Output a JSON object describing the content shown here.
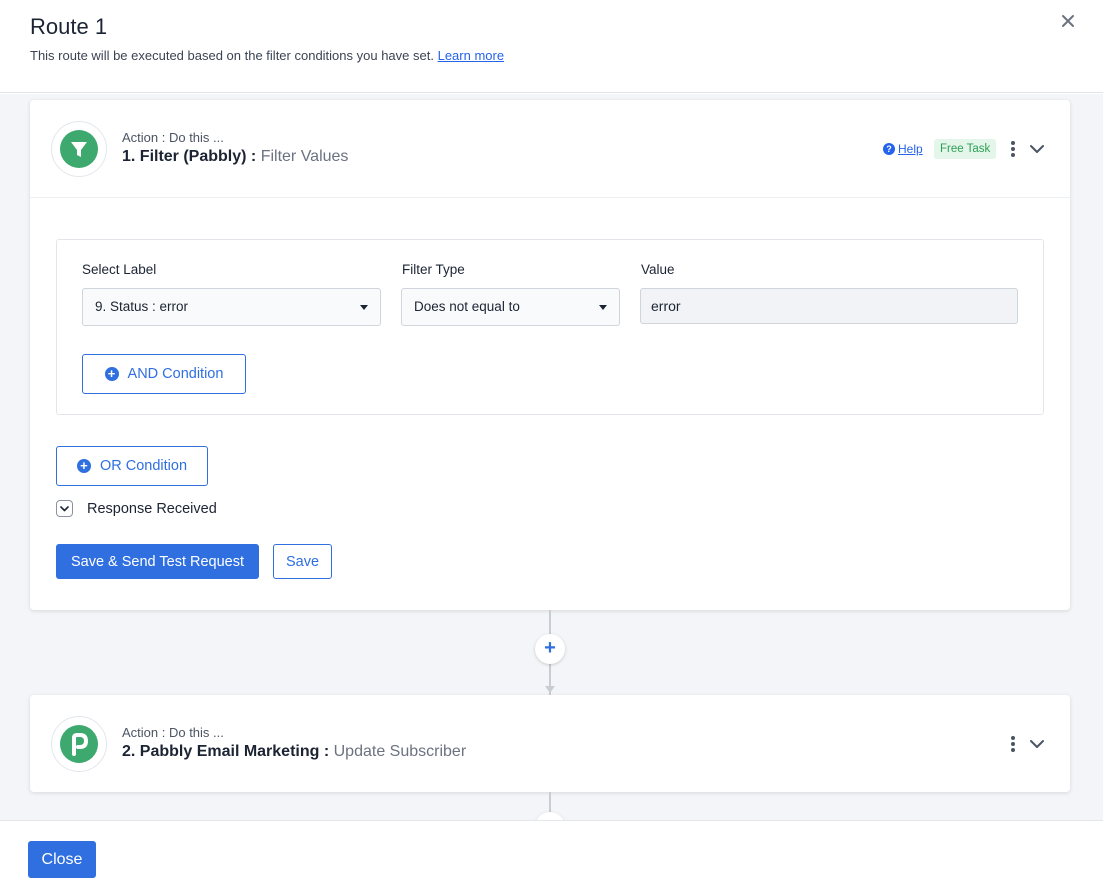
{
  "modal": {
    "title": "Route 1",
    "subtitle": "This route will be executed based on the filter conditions you have set.",
    "learn_more": "Learn more"
  },
  "step1": {
    "kicker": "Action : Do this ...",
    "app_name": "1. Filter (Pabbly) : ",
    "event": "Filter Values",
    "help_label": "Help",
    "badge": "Free Task",
    "columns": {
      "select_label": "Select Label",
      "filter_type": "Filter Type",
      "value": "Value"
    },
    "condition": {
      "label_value": "9. Status : error",
      "filter_type_value": "Does not equal to",
      "value": "error"
    },
    "and_condition": "AND Condition",
    "or_condition": "OR Condition",
    "response_label": "Response Received",
    "save_send": "Save & Send Test Request",
    "save": "Save"
  },
  "step2": {
    "kicker": "Action : Do this ...",
    "app_name": "2. Pabbly Email Marketing : ",
    "event": "Update Subscriber"
  },
  "footer": {
    "close": "Close"
  },
  "colors": {
    "primary": "#2f6fe0",
    "filter_green": "#3ea96f",
    "badge_bg": "#e3f6e9",
    "badge_text": "#2f9e57"
  }
}
